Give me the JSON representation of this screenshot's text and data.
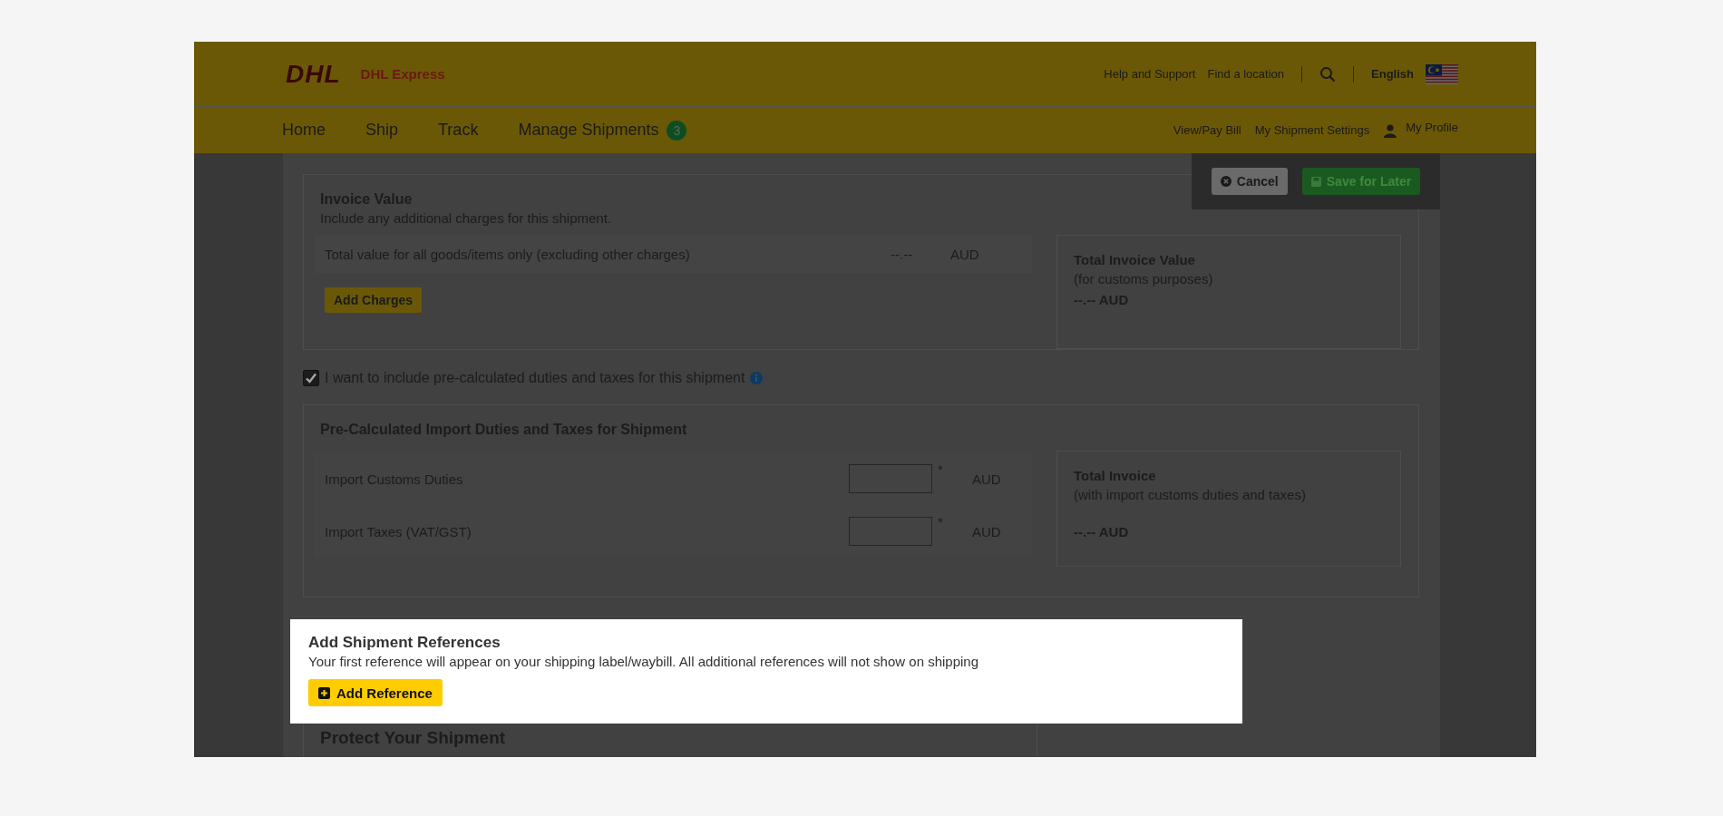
{
  "header": {
    "logo": "DHL",
    "brand": "DHL Express",
    "links": [
      "Help and Support",
      "Find a location"
    ],
    "language": "English"
  },
  "nav": {
    "items": [
      {
        "label": "Home"
      },
      {
        "label": "Ship"
      },
      {
        "label": "Track"
      },
      {
        "label": "Manage Shipments",
        "badge": "3"
      }
    ],
    "right_links": [
      "View/Pay Bill",
      "My Shipment Settings"
    ],
    "profile": "My Profile"
  },
  "actions": {
    "cancel": "Cancel",
    "save": "Save for Later"
  },
  "invoice": {
    "title": "Invoice Value",
    "subtitle": "Include any additional charges for this shipment.",
    "row_label": "Total value for all goods/items only (excluding other charges)",
    "row_value": "--.--",
    "row_currency": "AUD",
    "button": "Add Charges",
    "total_title": "Total Invoice Value",
    "total_note": "(for customs purposes)",
    "total_amount": "--.-- AUD"
  },
  "duties_option": {
    "label": "I want to include pre-calculated duties and taxes for this shipment",
    "checked": true
  },
  "duties": {
    "title": "Pre-Calculated Import Duties and Taxes for Shipment",
    "rows": [
      {
        "label": "Import Customs Duties",
        "required": "*",
        "currency": "AUD"
      },
      {
        "label": "Import Taxes (VAT/GST)",
        "required": "*",
        "currency": "AUD"
      }
    ],
    "total_title": "Total Invoice",
    "total_note": "(with import customs duties and taxes)",
    "total_amount": "--.-- AUD"
  },
  "references": {
    "title": "Add Shipment References",
    "description": "Your first reference will appear on your shipping label/waybill. All additional references will not show on shipping",
    "button": "Add Reference"
  },
  "protect": {
    "title": "Protect Your Shipment"
  }
}
